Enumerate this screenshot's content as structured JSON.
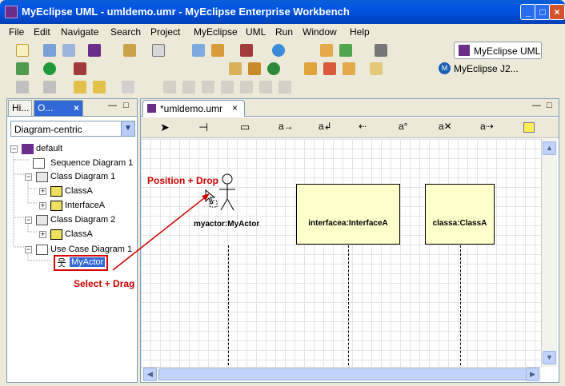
{
  "window": {
    "title": "MyEclipse UML - umldemo.umr - MyEclipse Enterprise Workbench"
  },
  "menu": [
    "File",
    "Edit",
    "Navigate",
    "Search",
    "Project",
    "MyEclipse",
    "UML",
    "Run",
    "Window",
    "Help"
  ],
  "perspectives": {
    "active": "MyEclipse UML",
    "other": "MyEclipse J2..."
  },
  "left_panel": {
    "tabs": [
      "Hi...",
      "O..."
    ],
    "combo_value": "Diagram-centric",
    "tree": [
      {
        "label": "default",
        "level": 0
      },
      {
        "label": "Sequence Diagram 1",
        "level": 1
      },
      {
        "label": "Class Diagram 1",
        "level": 1
      },
      {
        "label": "ClassA",
        "level": 2
      },
      {
        "label": "InterfaceA",
        "level": 2
      },
      {
        "label": "Class Diagram 2",
        "level": 1
      },
      {
        "label": "ClassA",
        "level": 2
      },
      {
        "label": "Use Case Diagram 1",
        "level": 1
      },
      {
        "label": "MyActor",
        "level": 2,
        "selected": true
      }
    ]
  },
  "editor": {
    "tab_label": "*umldemo.umr"
  },
  "diagram": {
    "actor_label": "myactor:MyActor",
    "box1_label": "interfacea:InterfaceA",
    "box2_label": "classa:ClassA"
  },
  "annotations": {
    "drop": "Position + Drop",
    "drag": "Select + Drag"
  },
  "colors": {
    "title_bar": "#0054e3",
    "selection": "#3168d5",
    "annotation": "#cc0000",
    "lifeline_fill": "#ffffcc"
  }
}
